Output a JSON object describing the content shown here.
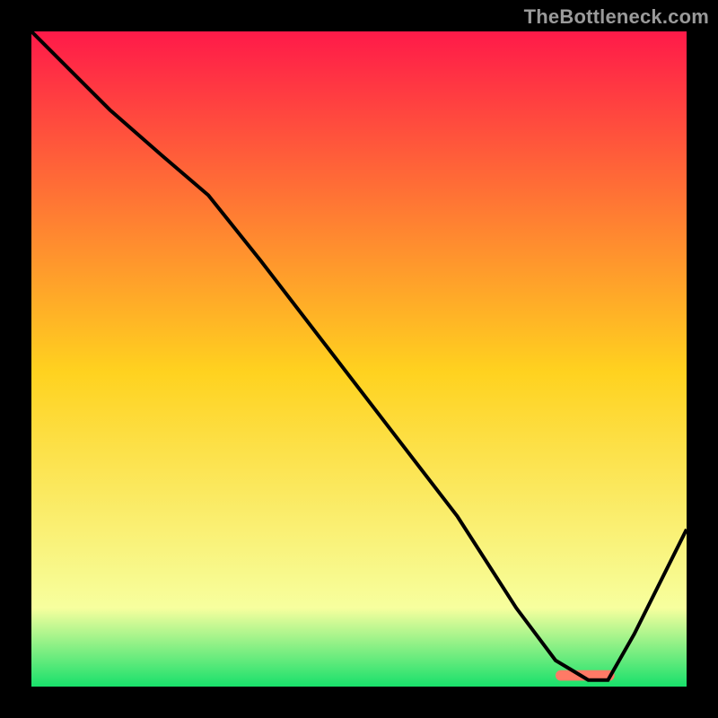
{
  "watermark": "TheBottleneck.com",
  "colors": {
    "bg": "#000000",
    "grad_top": "#ff1a49",
    "grad_mid": "#ffd21f",
    "grad_low": "#f7ff9e",
    "grad_bottom": "#18e06b",
    "curve": "#000000",
    "optimal_marker": "#ff7a66"
  },
  "chart_data": {
    "type": "line",
    "title": "",
    "xlabel": "",
    "ylabel": "",
    "xlim": [
      0,
      100
    ],
    "ylim": [
      0,
      100
    ],
    "series": [
      {
        "name": "bottleneck-curve",
        "x": [
          0,
          8,
          12,
          20,
          27,
          35,
          45,
          55,
          65,
          74,
          80,
          85,
          88,
          92,
          100
        ],
        "y": [
          100,
          92,
          88,
          81,
          75,
          65,
          52,
          39,
          26,
          12,
          4,
          1,
          1,
          8,
          24
        ]
      }
    ],
    "optimal_range_x": [
      80,
      89
    ],
    "annotations": []
  }
}
